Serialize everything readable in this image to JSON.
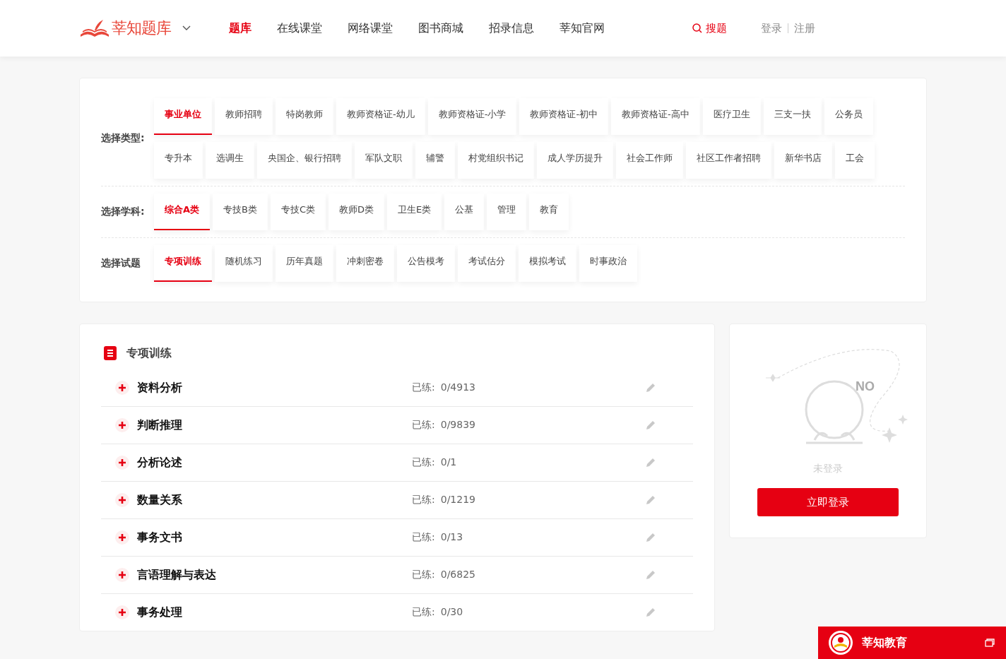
{
  "header": {
    "logo_text": "莘知题库",
    "nav": [
      {
        "label": "题库",
        "selected": true
      },
      {
        "label": "在线课堂",
        "selected": false
      },
      {
        "label": "网络课堂",
        "selected": false
      },
      {
        "label": "图书商城",
        "selected": false
      },
      {
        "label": "招录信息",
        "selected": false
      },
      {
        "label": "莘知官网",
        "selected": false
      }
    ],
    "search_label": "搜题",
    "login": "登录",
    "register": "注册"
  },
  "filters": [
    {
      "label": "选择类型:",
      "items": [
        {
          "label": "事业单位",
          "selected": true
        },
        {
          "label": "教师招聘",
          "selected": false
        },
        {
          "label": "特岗教师",
          "selected": false
        },
        {
          "label": "教师资格证-幼儿",
          "selected": false
        },
        {
          "label": "教师资格证-小学",
          "selected": false
        },
        {
          "label": "教师资格证-初中",
          "selected": false
        },
        {
          "label": "教师资格证-高中",
          "selected": false
        },
        {
          "label": "医疗卫生",
          "selected": false
        },
        {
          "label": "三支一扶",
          "selected": false
        },
        {
          "label": "公务员",
          "selected": false
        },
        {
          "label": "专升本",
          "selected": false
        },
        {
          "label": "选调生",
          "selected": false
        },
        {
          "label": "央国企、银行招聘",
          "selected": false
        },
        {
          "label": "军队文职",
          "selected": false
        },
        {
          "label": "辅警",
          "selected": false
        },
        {
          "label": "村党组织书记",
          "selected": false
        },
        {
          "label": "成人学历提升",
          "selected": false
        },
        {
          "label": "社会工作师",
          "selected": false
        },
        {
          "label": "社区工作者招聘",
          "selected": false
        },
        {
          "label": "新华书店",
          "selected": false
        },
        {
          "label": "工会",
          "selected": false
        }
      ]
    },
    {
      "label": "选择学科:",
      "items": [
        {
          "label": "综合A类",
          "selected": true
        },
        {
          "label": "专技B类",
          "selected": false
        },
        {
          "label": "专技C类",
          "selected": false
        },
        {
          "label": "教师D类",
          "selected": false
        },
        {
          "label": "卫生E类",
          "selected": false
        },
        {
          "label": "公基",
          "selected": false
        },
        {
          "label": "管理",
          "selected": false
        },
        {
          "label": "教育",
          "selected": false
        }
      ]
    },
    {
      "label": "选择试题",
      "items": [
        {
          "label": "专项训练",
          "selected": true
        },
        {
          "label": "随机练习",
          "selected": false
        },
        {
          "label": "历年真题",
          "selected": false
        },
        {
          "label": "冲刺密卷",
          "selected": false
        },
        {
          "label": "公告模考",
          "selected": false
        },
        {
          "label": "考试估分",
          "selected": false
        },
        {
          "label": "模拟考试",
          "selected": false
        },
        {
          "label": "时事政治",
          "selected": false
        }
      ]
    }
  ],
  "practice": {
    "title": "专项训练",
    "items": [
      {
        "name": "资料分析",
        "done_label": "已练:",
        "count": "0/4913"
      },
      {
        "name": "判断推理",
        "done_label": "已练:",
        "count": "0/9839"
      },
      {
        "name": "分析论述",
        "done_label": "已练:",
        "count": "0/1"
      },
      {
        "name": "数量关系",
        "done_label": "已练:",
        "count": "0/1219"
      },
      {
        "name": "事务文书",
        "done_label": "已练:",
        "count": "0/13"
      },
      {
        "name": "言语理解与表达",
        "done_label": "已练:",
        "count": "0/6825"
      },
      {
        "name": "事务处理",
        "done_label": "已练:",
        "count": "0/30"
      }
    ]
  },
  "login_card": {
    "illustration_text": "NO",
    "status": "未登录",
    "button": "立即登录"
  },
  "float_bar": {
    "title": "莘知教育"
  }
}
